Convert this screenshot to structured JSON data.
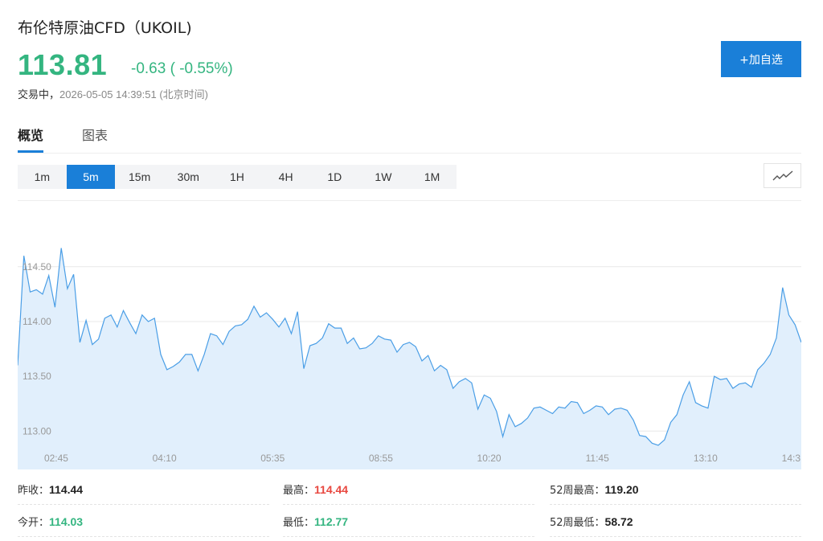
{
  "header": {
    "title": "布伦特原油CFD（UKOIL)",
    "price": "113.81",
    "change": "-0.63 ( -0.55%)",
    "status_label": "交易中，",
    "timestamp": "2026-05-05 14:39:51 (北京时间)",
    "watch_label": "+加自选"
  },
  "tabs": [
    {
      "label": "概览",
      "active": true
    },
    {
      "label": "图表",
      "active": false
    }
  ],
  "periods": [
    {
      "label": "1m",
      "active": false
    },
    {
      "label": "5m",
      "active": true
    },
    {
      "label": "15m",
      "active": false
    },
    {
      "label": "30m",
      "active": false
    },
    {
      "label": "1H",
      "active": false
    },
    {
      "label": "4H",
      "active": false
    },
    {
      "label": "1D",
      "active": false
    },
    {
      "label": "1W",
      "active": false
    },
    {
      "label": "1M",
      "active": false
    }
  ],
  "chart_type_icon": "line-chart-icon",
  "colors": {
    "accent": "#1a7fd8",
    "down": "#34b580",
    "up": "#e8473f",
    "line": "#4a9ee6",
    "area": "#e1effc"
  },
  "stats": [
    {
      "label": "昨收：",
      "value": "114.44",
      "tone": "dark"
    },
    {
      "label": "最高：",
      "value": "114.44",
      "tone": "up"
    },
    {
      "label": "52周最高：",
      "value": "119.20",
      "tone": "dark"
    },
    {
      "label": "今开：",
      "value": "114.03",
      "tone": "down"
    },
    {
      "label": "最低：",
      "value": "112.77",
      "tone": "down"
    },
    {
      "label": "52周最低：",
      "value": "58.72",
      "tone": "dark"
    }
  ],
  "chart_data": {
    "type": "area",
    "ylim": [
      112.65,
      115.1
    ],
    "yticks": [
      113.0,
      113.5,
      114.0,
      114.5
    ],
    "ytick_labels": [
      "113.00",
      "113.50",
      "114.00",
      "114.50"
    ],
    "xtick_labels": [
      "02:45",
      "04:10",
      "05:35",
      "08:55",
      "10:20",
      "11:45",
      "13:10",
      "14:3"
    ],
    "xtick_index": [
      6.2,
      23.6,
      41.0,
      58.4,
      75.8,
      93.2,
      110.6,
      128.0
    ],
    "grid": true,
    "legend": "none",
    "values": [
      113.6,
      114.6,
      114.27,
      114.29,
      114.25,
      114.42,
      114.13,
      114.67,
      114.3,
      114.43,
      113.81,
      114.01,
      113.79,
      113.84,
      114.03,
      114.06,
      113.95,
      114.1,
      113.99,
      113.89,
      114.06,
      114.0,
      114.03,
      113.7,
      113.56,
      113.59,
      113.63,
      113.7,
      113.7,
      113.55,
      113.7,
      113.89,
      113.87,
      113.79,
      113.91,
      113.96,
      113.97,
      114.02,
      114.14,
      114.04,
      114.08,
      114.02,
      113.95,
      114.03,
      113.89,
      114.09,
      113.57,
      113.78,
      113.8,
      113.85,
      113.98,
      113.94,
      113.94,
      113.8,
      113.85,
      113.75,
      113.76,
      113.8,
      113.87,
      113.84,
      113.83,
      113.72,
      113.79,
      113.81,
      113.77,
      113.64,
      113.69,
      113.55,
      113.6,
      113.56,
      113.39,
      113.45,
      113.48,
      113.44,
      113.2,
      113.33,
      113.3,
      113.18,
      112.95,
      113.15,
      113.04,
      113.07,
      113.12,
      113.21,
      113.22,
      113.19,
      113.16,
      113.22,
      113.21,
      113.27,
      113.26,
      113.16,
      113.19,
      113.23,
      113.22,
      113.15,
      113.2,
      113.21,
      113.19,
      113.1,
      112.96,
      112.95,
      112.89,
      112.87,
      112.92,
      113.08,
      113.15,
      113.33,
      113.45,
      113.26,
      113.23,
      113.21,
      113.5,
      113.47,
      113.48,
      113.39,
      113.43,
      113.44,
      113.4,
      113.56,
      113.62,
      113.7,
      113.85,
      114.31,
      114.06,
      113.97,
      113.81
    ]
  }
}
